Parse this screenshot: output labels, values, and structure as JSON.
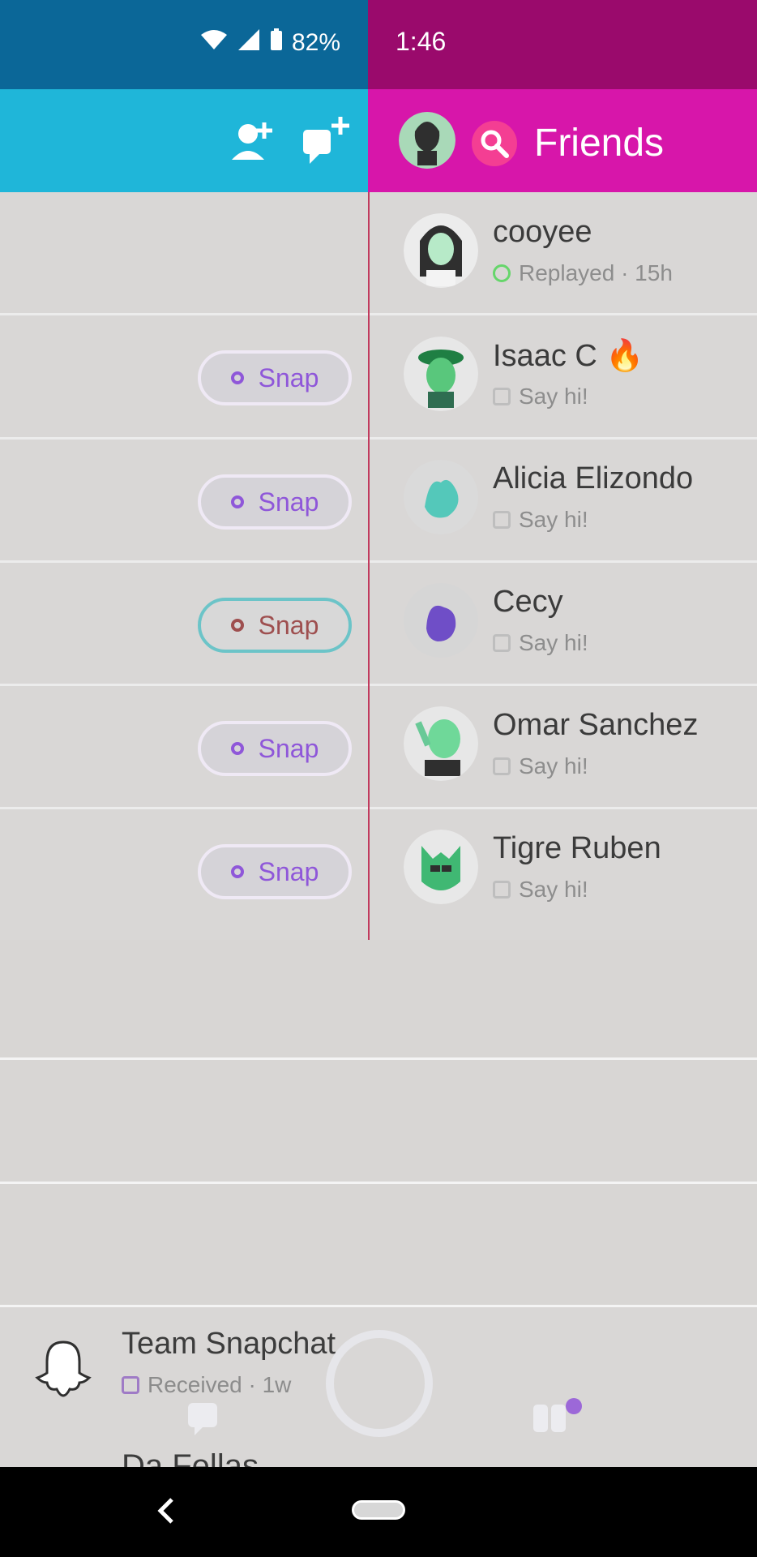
{
  "status_bar": {
    "battery_percent": "82%",
    "time": "1:46"
  },
  "friends_header": {
    "title": "Friends"
  },
  "left_snap_buttons": [
    {
      "label": "Snap"
    },
    {
      "label": "Snap"
    },
    {
      "label": "Snap"
    },
    {
      "label": "Snap"
    },
    {
      "label": "Snap"
    }
  ],
  "friends": [
    {
      "name": "cooyee",
      "status": "Replayed · 15h",
      "icon": "replay-icon"
    },
    {
      "name": "Isaac C",
      "status": "Say hi!",
      "icon": "chat-icon",
      "emoji": "🔥"
    },
    {
      "name": "Alicia Elizondo",
      "status": "Say hi!",
      "icon": "chat-icon"
    },
    {
      "name": "Cecy",
      "status": "Say hi!",
      "icon": "chat-icon"
    },
    {
      "name": "Omar Sanchez",
      "status": "Say hi!",
      "icon": "chat-icon"
    },
    {
      "name": "Tigre Ruben",
      "status": "Say hi!",
      "icon": "chat-icon"
    }
  ],
  "bottom_chat": {
    "title": "Team Snapchat",
    "status": "Received · 1w",
    "next_title": "Da Fellas"
  },
  "colors": {
    "left_status": "#0b6798",
    "right_status": "#9a0a6c",
    "left_header": "#1fb6d9",
    "right_header": "#d716aa"
  }
}
